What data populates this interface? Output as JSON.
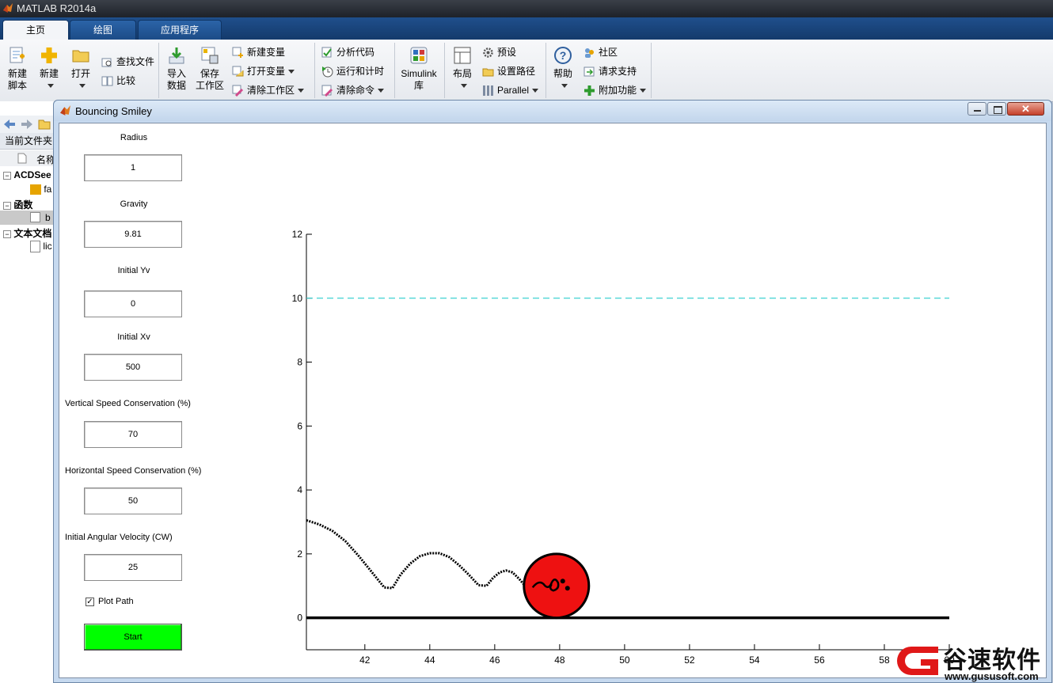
{
  "app_window": {
    "title": "MATLAB R2014a"
  },
  "tabs": [
    "主页",
    "绘图",
    "应用程序"
  ],
  "ribbon": {
    "new_script": [
      "新建",
      "脚本"
    ],
    "new": "新建",
    "open": "打开",
    "find_files": "查找文件",
    "compare": "比较",
    "import_data": [
      "导入",
      "数据"
    ],
    "save_workspace": [
      "保存",
      "工作区"
    ],
    "new_variable": "新建变量",
    "open_variable": "打开变量",
    "clear_workspace": "清除工作区",
    "analyze_code": "分析代码",
    "run_and_time": "运行和计时",
    "clear_commands": "清除命令",
    "simulink": [
      "Simulink",
      "库"
    ],
    "layout": "布局",
    "preferences": "预设",
    "set_path": "设置路径",
    "parallel": "Parallel",
    "help": "帮助",
    "community": "社区",
    "request_support": "请求支持",
    "addons": "附加功能"
  },
  "left_panel": {
    "current_folder": "当前文件夹",
    "name_header": "名称",
    "groups": [
      {
        "label": "ACDSee",
        "child": "fa"
      },
      {
        "label": "函数",
        "child": "b"
      },
      {
        "label": "文本文档",
        "child": "lic"
      }
    ]
  },
  "figure": {
    "title": "Bouncing Smiley",
    "controls": {
      "radius_label": "Radius",
      "radius_value": "1",
      "gravity_label": "Gravity",
      "gravity_value": "9.81",
      "init_yv_label": "Initial Yv",
      "init_yv_value": "0",
      "init_xv_label": "Initial Xv",
      "init_xv_value": "500",
      "vsc_label": "Vertical Speed Conservation (%)",
      "vsc_value": "70",
      "hsc_label": "Horizontal Speed Conservation (%)",
      "hsc_value": "50",
      "ang_label": "Initial Angular Velocity (CW)",
      "ang_value": "25",
      "plot_path_label": "Plot Path",
      "plot_path_checked": true,
      "start_label": "Start"
    }
  },
  "chart_data": {
    "type": "line",
    "xlim": [
      40.2,
      60
    ],
    "ylim": [
      -1,
      12
    ],
    "xticks": [
      42,
      44,
      46,
      48,
      50,
      52,
      54,
      56,
      58,
      60
    ],
    "yticks": [
      0,
      2,
      4,
      6,
      8,
      10,
      12
    ],
    "xtick_labels": [
      "42",
      "44",
      "46",
      "48",
      "50",
      "52",
      "54",
      "56",
      "58",
      "60"
    ],
    "ytick_labels": [
      "0",
      "2",
      "4",
      "6",
      "8",
      "10",
      "12"
    ],
    "ceiling": {
      "y": 10,
      "color": "#3fd1d1",
      "style": "dashed"
    },
    "ground": {
      "y": 0,
      "color": "#000000"
    },
    "path": {
      "x": [
        40.2,
        40.6,
        41.0,
        41.4,
        41.8,
        42.2,
        42.6,
        42.85,
        43.1,
        43.4,
        43.7,
        44.0,
        44.3,
        44.6,
        44.9,
        45.2,
        45.5,
        45.75,
        45.95,
        46.15,
        46.35,
        46.55,
        46.75,
        46.95,
        47.15
      ],
      "y": [
        3.05,
        2.92,
        2.72,
        2.4,
        1.95,
        1.45,
        0.95,
        0.93,
        1.35,
        1.7,
        1.93,
        2.02,
        2.02,
        1.9,
        1.65,
        1.35,
        1.02,
        1.0,
        1.25,
        1.42,
        1.48,
        1.42,
        1.22,
        0.98,
        1.02
      ]
    },
    "ball": {
      "x": 47.9,
      "y": 1.0,
      "radius": 1,
      "color": "#ee1111"
    },
    "colors": {
      "axis": "#000000",
      "ceiling": "#3fd1d1"
    }
  },
  "watermark": {
    "text": "谷速软件",
    "url": "www.gususoft.com",
    "color": "#e01818"
  }
}
